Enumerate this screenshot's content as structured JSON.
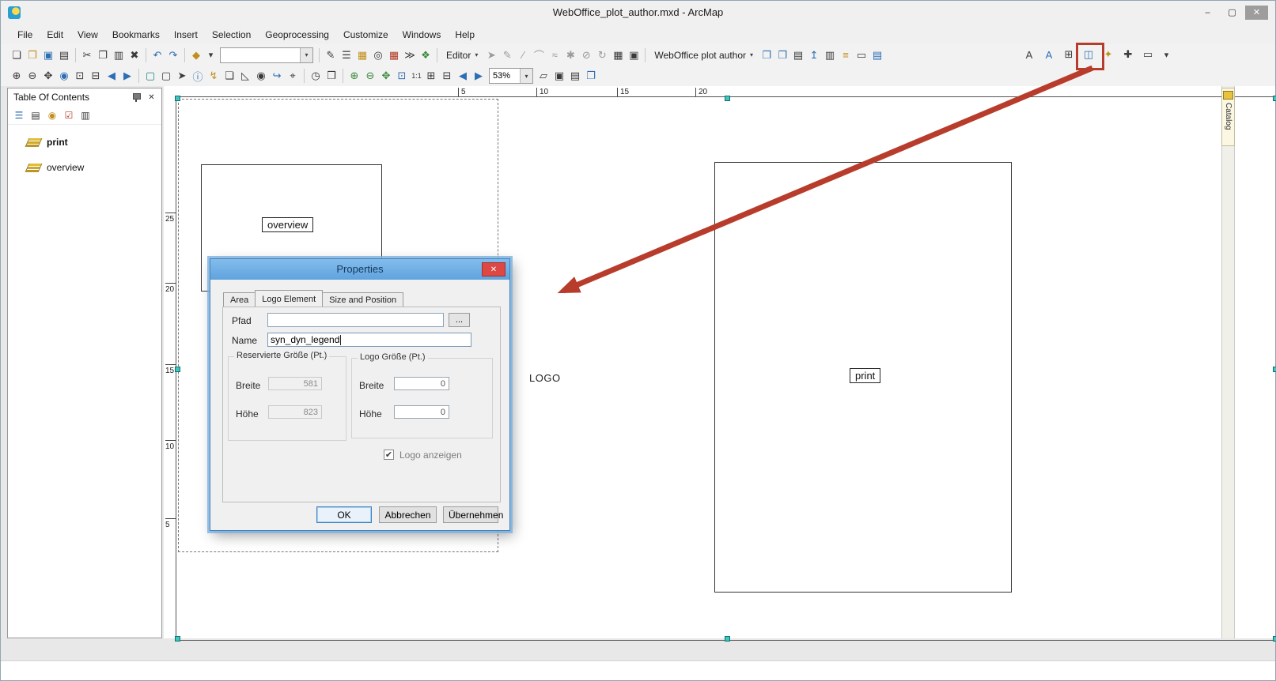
{
  "window": {
    "title": "WebOffice_plot_author.mxd - ArcMap",
    "minimize": "–",
    "maximize": "▢",
    "close": "✕"
  },
  "menubar": [
    "File",
    "Edit",
    "View",
    "Bookmarks",
    "Insert",
    "Selection",
    "Geoprocessing",
    "Customize",
    "Windows",
    "Help"
  ],
  "ui": {
    "caret": "▾",
    "check": "✔"
  },
  "tb1": {
    "file_glyphs": [
      "❏",
      "❒",
      "▣",
      "▤"
    ],
    "edit_glyphs": [
      "✂",
      "❐",
      "▥",
      "✖"
    ],
    "undo_glyphs": [
      "↶",
      "↷"
    ],
    "add_data_glyph": "◆",
    "scale_value": "",
    "window_glyphs": [
      "✎",
      "☰",
      "▦",
      "◎",
      "▦",
      "≫",
      "❖"
    ],
    "editor_label": "Editor",
    "editor_tool_glyphs": [
      "➤",
      "✎",
      "∕",
      "⌒",
      "≈",
      "✱",
      "⊘",
      "↻"
    ],
    "extra_glyphs": [
      "▦",
      "▣"
    ],
    "weboffice_label": "WebOffice plot author",
    "weboffice_glyphs": [
      "❐",
      "❐",
      "▤",
      "↥",
      "▥",
      "≡",
      "▭",
      "▤"
    ],
    "tail_glyphs": [
      "A",
      "A",
      "⊞",
      "◫",
      "✦",
      "✚",
      "▭"
    ]
  },
  "tb2": {
    "nav_glyphs": [
      "⊕",
      "⊖",
      "✥",
      "◉",
      "⊡",
      "⊟",
      "◀",
      "▶"
    ],
    "tool_glyphs": [
      "▢",
      "▢",
      "➤",
      "ⓘ",
      "↯",
      "❏",
      "◺",
      "◉",
      "↪",
      "⌖",
      "◷",
      "❒"
    ],
    "layout_glyphs": [
      "⊕",
      "⊖",
      "✥",
      "⊡"
    ],
    "zoom_100": "1:1",
    "layout_glyphs2": [
      "⊞",
      "⊟",
      "◀",
      "▶"
    ],
    "zoom_value": "53%",
    "page_glyphs": [
      "▱",
      "▣",
      "▤",
      "❐"
    ]
  },
  "toc": {
    "title": "Table Of Contents",
    "close_glyph": "✕",
    "toolbar_glyphs": [
      "☰",
      "▤",
      "◉",
      "☑",
      "▥"
    ],
    "items": [
      "print",
      "overview"
    ]
  },
  "catalog": {
    "label": "Catalog"
  },
  "ruler": {
    "h": [
      "5",
      "10",
      "15",
      "20"
    ],
    "v": [
      "25",
      "20",
      "15",
      "10",
      "5"
    ]
  },
  "canvas": {
    "overview_label": "overview",
    "logo_label": "LOGO",
    "print_label": "print"
  },
  "dialog": {
    "title": "Properties",
    "close_glyph": "✕",
    "tabs": [
      "Area",
      "Logo Element",
      "Size and Position"
    ],
    "pfad_label": "Pfad",
    "pfad_value": "",
    "browse": "...",
    "name_label": "Name",
    "name_value": "syn_dyn_legend",
    "group_reserved": "Reservierte Größe (Pt.)",
    "group_logo": "Logo Größe (Pt.)",
    "breite": "Breite",
    "hoehe": "Höhe",
    "reserved_breite": "581",
    "reserved_hoehe": "823",
    "logo_breite": "0",
    "logo_hoehe": "0",
    "checkbox_label": "Logo anzeigen",
    "ok": "OK",
    "cancel": "Abbrechen",
    "apply": "Übernehmen"
  }
}
